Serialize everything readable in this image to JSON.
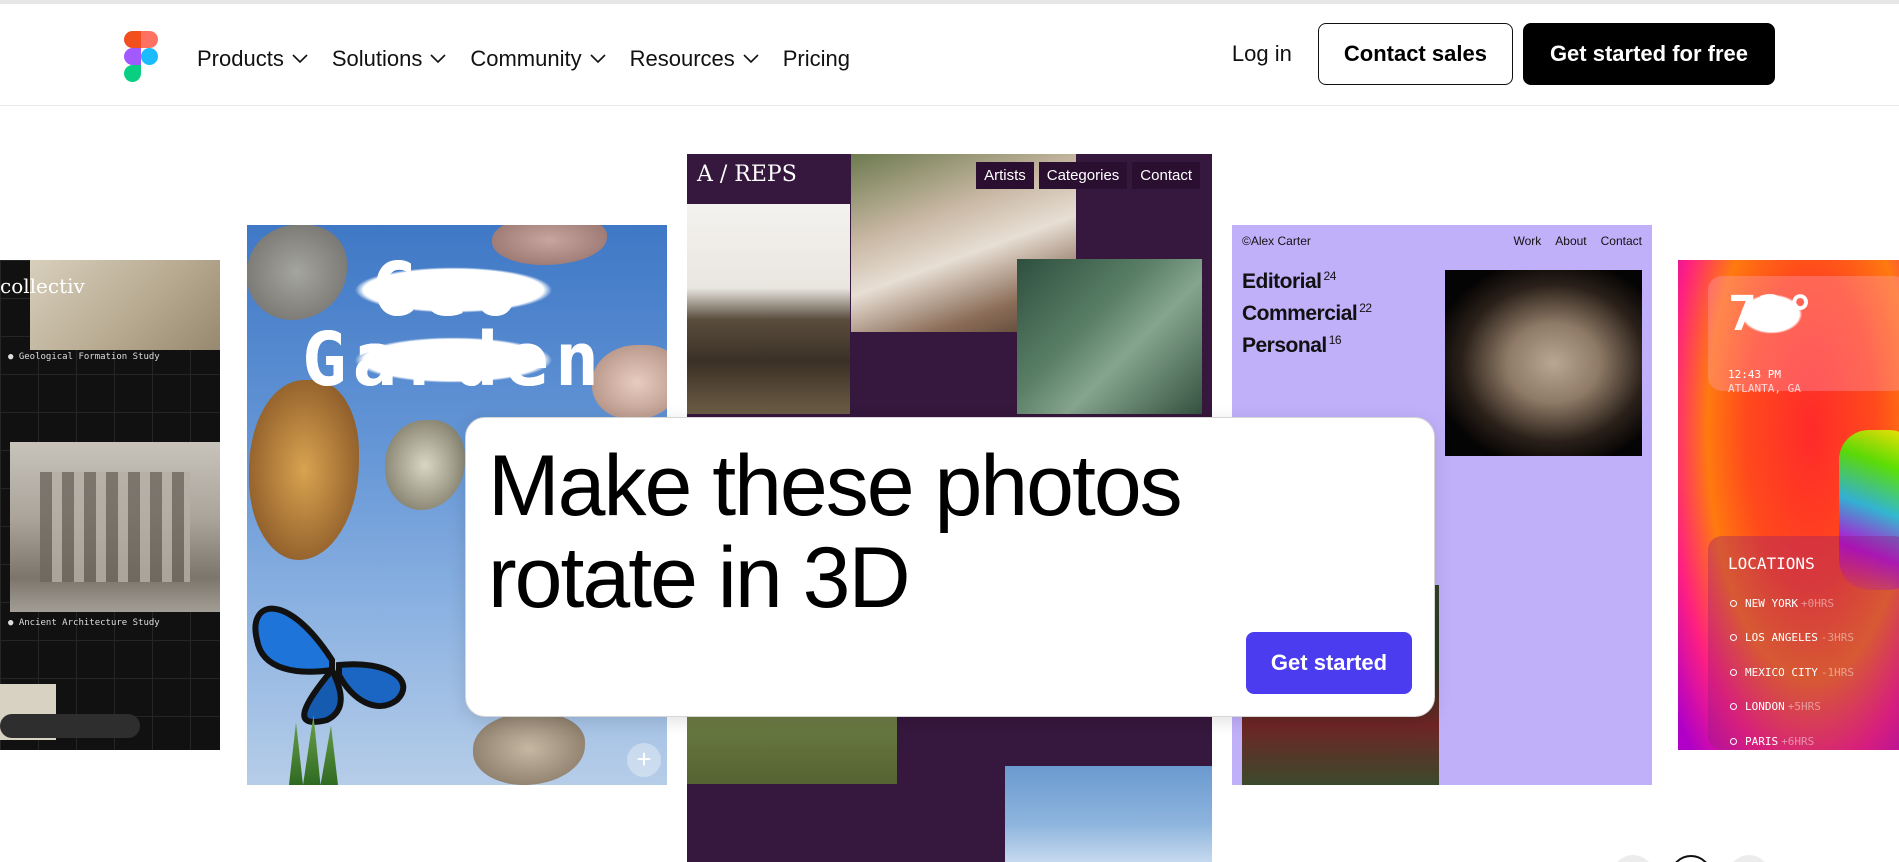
{
  "nav": {
    "items": [
      {
        "label": "Products",
        "has_dropdown": true
      },
      {
        "label": "Solutions",
        "has_dropdown": true
      },
      {
        "label": "Community",
        "has_dropdown": true
      },
      {
        "label": "Resources",
        "has_dropdown": true
      },
      {
        "label": "Pricing",
        "has_dropdown": false
      }
    ],
    "login": "Log in",
    "contact_sales": "Contact sales",
    "get_started_free": "Get started for free"
  },
  "cards": {
    "collective": {
      "title": "collectiv",
      "caption1": "● Geological Formation Study",
      "caption2": "● Ancient Architecture Study"
    },
    "geo_garden": {
      "title_line1": "Geo",
      "title_line2": "Garden",
      "add_icon": "plus-icon"
    },
    "areps": {
      "brand": "A / REPS",
      "menu": [
        "Artists",
        "Categories",
        "Contact"
      ]
    },
    "alex_carter": {
      "name": "©Alex Carter",
      "menu": [
        "Work",
        "About",
        "Contact"
      ],
      "categories": [
        {
          "label": "Editorial",
          "count": "24"
        },
        {
          "label": "Commercial",
          "count": "22"
        },
        {
          "label": "Personal",
          "count": "16"
        }
      ]
    },
    "weather": {
      "temperature": "72°",
      "time": "12:43 PM",
      "city": "ATLANTA, GA",
      "locations_heading": "LOCATIONS",
      "locations": [
        {
          "name": "NEW YORK",
          "offset": "+0HRS"
        },
        {
          "name": "LOS ANGELES",
          "offset": "-3HRS"
        },
        {
          "name": "MEXICO CITY",
          "offset": "-1HRS"
        },
        {
          "name": "LONDON",
          "offset": "+5HRS"
        },
        {
          "name": "PARIS",
          "offset": "+6HRS"
        }
      ]
    }
  },
  "prompt": {
    "text_line1": "Make these photos",
    "text_line2": "rotate in 3D",
    "button": "Get started"
  },
  "colors": {
    "primary_cta": "#4b3cf0",
    "dark_button": "#000000",
    "areps_bg": "#36173d",
    "alex_bg": "#c0b0fa"
  }
}
